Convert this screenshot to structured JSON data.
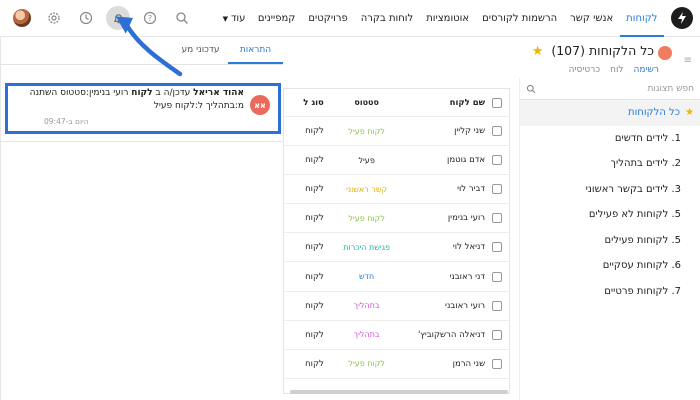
{
  "nav": {
    "items": [
      "לקוחות",
      "אנשי קשר",
      "הרשמות לקורסים",
      "אוטומציות",
      "לוחות בקרה",
      "פרויקטים",
      "קמפיינים"
    ],
    "more_label": "עוד"
  },
  "header": {
    "title": "כל הלקוחות",
    "count": "(107)",
    "tabs": [
      "רשימה",
      "לוח",
      "כרטיסיה"
    ]
  },
  "sidebar": {
    "search_placeholder": "חפש תצוגות",
    "items": [
      "כל הלקוחות",
      "1. לידים חדשים",
      "2. לידים בתהליך",
      "3. לידים בקשר ראשוני",
      "5. לקוחות לא פעילים",
      "5. לקוחות פעילים",
      "6. לקוחות עסקיים",
      "7. לקוחות פרטיים"
    ]
  },
  "table": {
    "headers": {
      "name": "שם לקוח",
      "status": "סטטוס",
      "type": "סוג ל"
    },
    "rows": [
      {
        "name": "שני קליין",
        "status": "לקוח פעיל",
        "type": "לקוח",
        "color": "#8bc34a"
      },
      {
        "name": "אדם גוטמן",
        "status": "פעיל",
        "type": "לקוח",
        "color": "#222222"
      },
      {
        "name": "דביר לוי",
        "status": "קשר ראשוני",
        "type": "לקוח",
        "color": "#e0b000"
      },
      {
        "name": "רועי בנימין",
        "status": "לקוח פעיל",
        "type": "לקוח",
        "color": "#8bc34a"
      },
      {
        "name": "דניאל לוי",
        "status": "פגישת היכרות",
        "type": "לקוח",
        "color": "#26b5a3"
      },
      {
        "name": "דני ראובני",
        "status": "חדש",
        "type": "לקוח",
        "color": "#2b7bd9"
      },
      {
        "name": "רועי ראובני",
        "status": "בתהליך",
        "type": "לקוח",
        "color": "#d14fd8"
      },
      {
        "name": "דניאלה הרשקוביץ'",
        "status": "בתהליך",
        "type": "לקוח",
        "color": "#d14fd8"
      },
      {
        "name": "שני הרמן",
        "status": "לקוח פעיל",
        "type": "לקוח",
        "color": "#8bc34a"
      }
    ]
  },
  "notifications": {
    "tabs": [
      "התראות",
      "עדכוני מע"
    ],
    "item": {
      "avatar": "אא",
      "author": "אהוד אריאל",
      "text1": "עדכן/ה ב",
      "entity": "לקוח",
      "text2": "רועי בנימין:סטטוס השתנה מ:בתהליך ל:לקוח פעיל",
      "time": "היום ב-09:47"
    }
  },
  "colors": {
    "accent": "#2b7bd9",
    "highlight_border": "#2e6fd6",
    "avatar_bg": "#ec6a5c",
    "star": "#f0b400"
  },
  "icons": [
    "logo-icon",
    "search-icon",
    "help-icon",
    "bell-icon",
    "clock-icon",
    "gear-icon",
    "avatar",
    "star-icon",
    "menu-icon",
    "trophy-icon"
  ]
}
